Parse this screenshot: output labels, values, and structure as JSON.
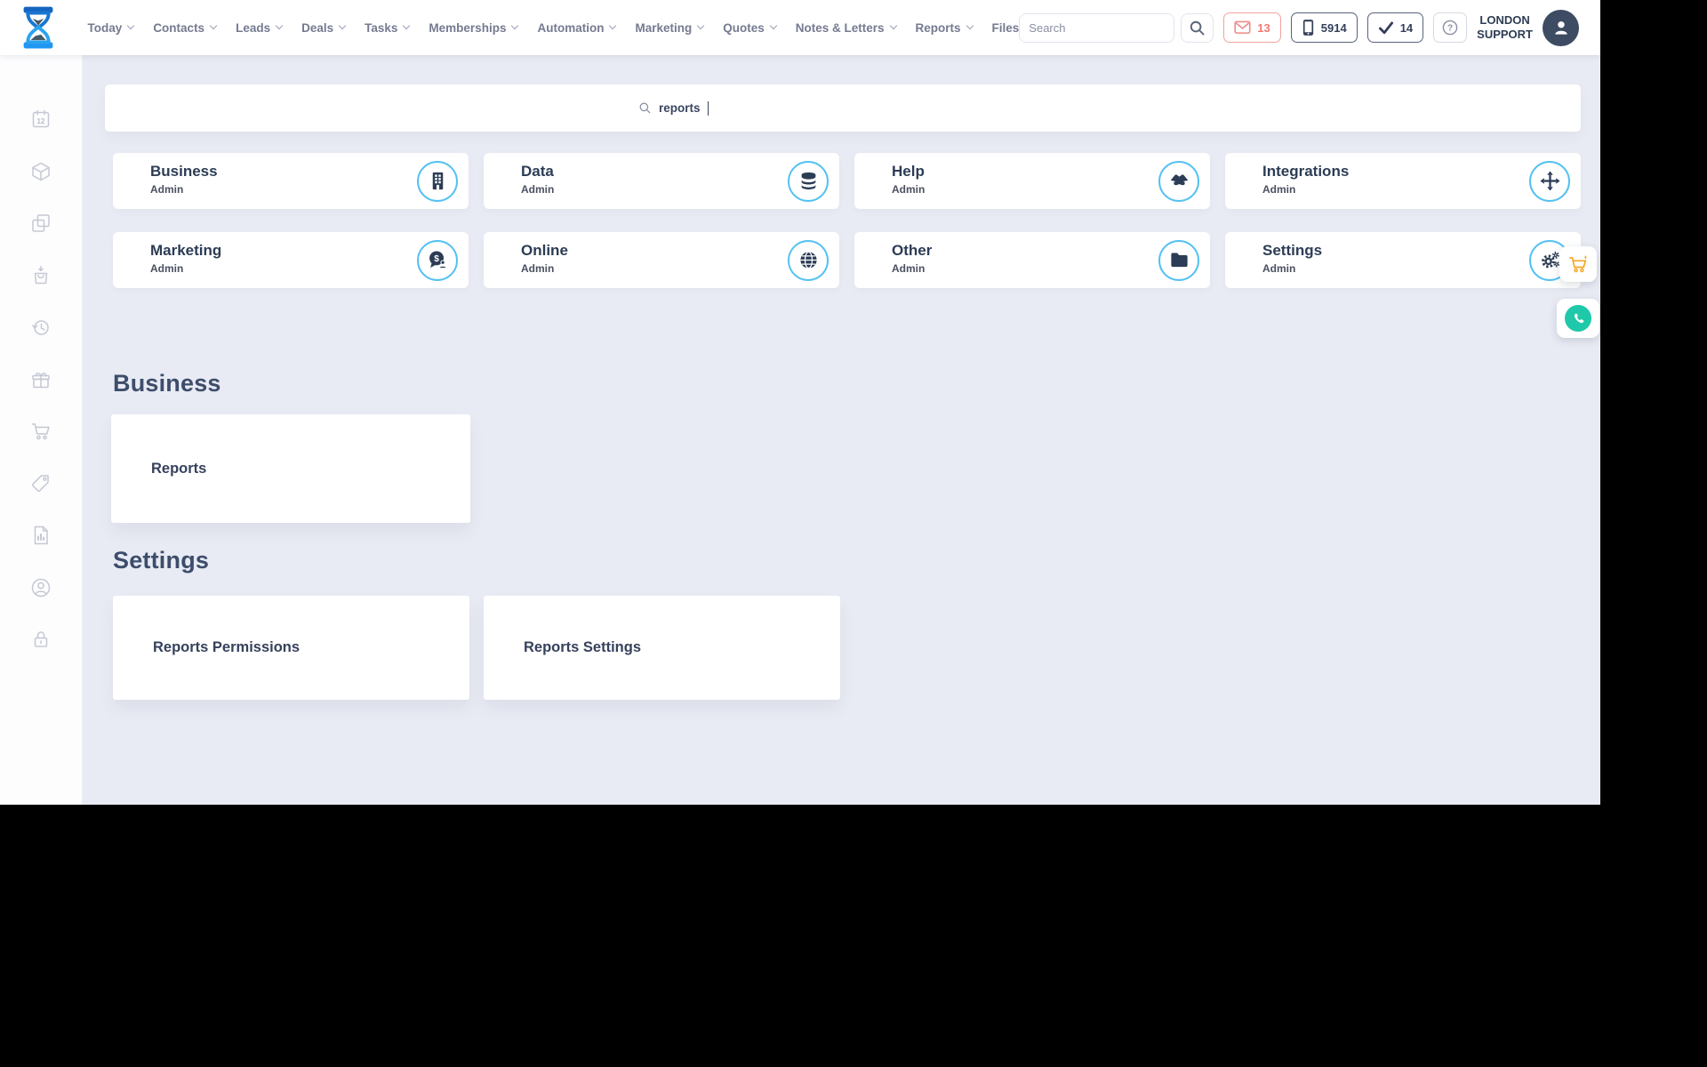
{
  "header": {
    "nav": [
      {
        "label": "Today"
      },
      {
        "label": "Contacts"
      },
      {
        "label": "Leads"
      },
      {
        "label": "Deals"
      },
      {
        "label": "Tasks"
      },
      {
        "label": "Memberships"
      },
      {
        "label": "Automation"
      },
      {
        "label": "Marketing"
      },
      {
        "label": "Quotes"
      },
      {
        "label": "Notes & Letters"
      },
      {
        "label": "Reports"
      },
      {
        "label": "Files"
      }
    ],
    "search_placeholder": "Search",
    "badges": {
      "mail_count": "13",
      "calls_count": "5914",
      "tasks_count": "14"
    },
    "help_glyph": "?",
    "user_name_line1": "LONDON",
    "user_name_line2": "SUPPORT"
  },
  "sidebar": {
    "calendar_day": "12",
    "icons": [
      "calendar-icon",
      "package-icon",
      "copy-icon",
      "bag-download-icon",
      "history-icon",
      "gift-icon",
      "cart-icon",
      "price-tag-icon",
      "report-document-icon",
      "user-circle-icon",
      "lock-icon"
    ]
  },
  "overlay": {
    "search_value": "reports",
    "categories": [
      {
        "title": "Business",
        "subtitle": "Admin",
        "icon": "building-icon"
      },
      {
        "title": "Data",
        "subtitle": "Admin",
        "icon": "database-icon"
      },
      {
        "title": "Help",
        "subtitle": "Admin",
        "icon": "handshake-icon"
      },
      {
        "title": "Integrations",
        "subtitle": "Admin",
        "icon": "move-arrows-icon"
      },
      {
        "title": "Marketing",
        "subtitle": "Admin",
        "icon": "comment-dollar-icon"
      },
      {
        "title": "Online",
        "subtitle": "Admin",
        "icon": "globe-icon"
      },
      {
        "title": "Other",
        "subtitle": "Admin",
        "icon": "folder-icon"
      },
      {
        "title": "Settings",
        "subtitle": "Admin",
        "icon": "gears-icon"
      }
    ],
    "marketing_icon_symbol": "$",
    "sections": [
      {
        "heading": "Business",
        "results": [
          "Reports"
        ]
      },
      {
        "heading": "Settings",
        "results": [
          "Reports Permissions",
          "Reports Settings"
        ]
      }
    ]
  },
  "colors": {
    "accent_ring": "#55c1f2",
    "icon_navy": "#2c3c55",
    "badge_salmon": "#ee7a74",
    "badge_dark": "#34405c",
    "cart_orange": "#f5a623",
    "phone_teal": "#1fc8a9",
    "background": "#e9ebf4"
  }
}
